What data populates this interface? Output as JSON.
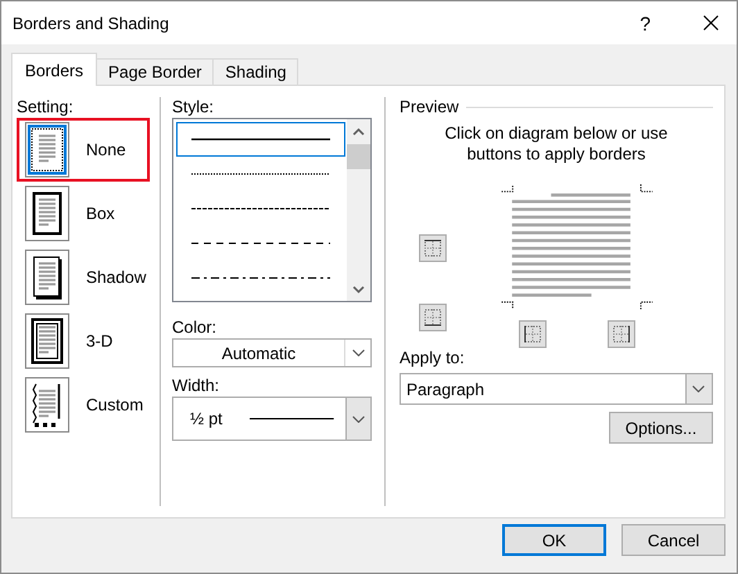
{
  "window": {
    "title": "Borders and Shading",
    "help": "?"
  },
  "tabs": [
    {
      "label": "Borders",
      "selected": true
    },
    {
      "label": "Page Border",
      "selected": false
    },
    {
      "label": "Shading",
      "selected": false
    }
  ],
  "setting": {
    "label": "Setting:",
    "items": [
      {
        "label": "None",
        "kind": "none",
        "selected": true
      },
      {
        "label": "Box",
        "kind": "box",
        "selected": false
      },
      {
        "label": "Shadow",
        "kind": "shadow",
        "selected": false
      },
      {
        "label": "3-D",
        "kind": "three-d",
        "selected": false
      },
      {
        "label": "Custom",
        "kind": "custom",
        "selected": false
      }
    ]
  },
  "style": {
    "label": "Style:",
    "items": [
      {
        "kind": "solid",
        "selected": true
      },
      {
        "kind": "dotted",
        "selected": false
      },
      {
        "kind": "dashed",
        "selected": false
      },
      {
        "kind": "dash-spaced",
        "selected": false
      },
      {
        "kind": "dash-dot",
        "selected": false
      }
    ]
  },
  "color": {
    "label": "Color:",
    "value": "Automatic"
  },
  "width": {
    "label": "Width:",
    "value": "½ pt"
  },
  "preview": {
    "title": "Preview",
    "instructions": "Click on diagram below or use buttons to apply borders"
  },
  "apply_to": {
    "label": "Apply to:",
    "value": "Paragraph"
  },
  "options_button": "Options...",
  "buttons": [
    "OK",
    "Cancel"
  ]
}
